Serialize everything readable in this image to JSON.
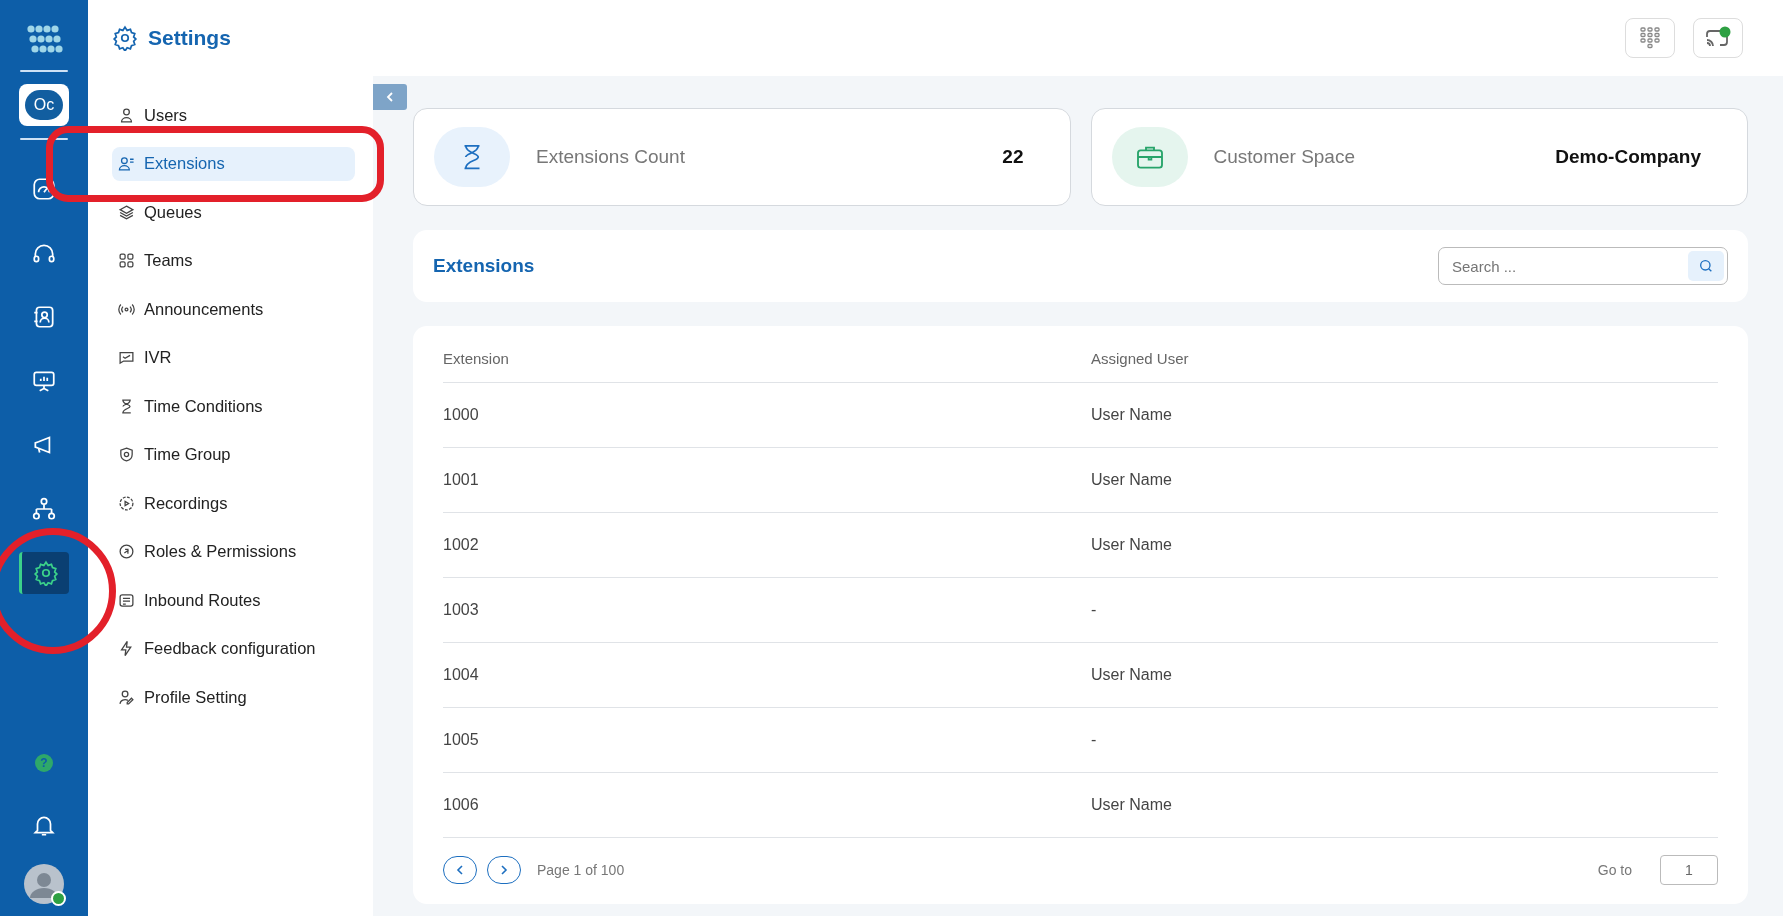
{
  "rail": {
    "workspace_badge": "Oc",
    "items": [
      {
        "selected": false
      },
      {
        "selected": false
      },
      {
        "selected": false
      },
      {
        "selected": false
      },
      {
        "selected": false
      },
      {
        "selected": false
      },
      {
        "selected": true
      }
    ],
    "help_mark": "?"
  },
  "settings_menu": {
    "title": "Settings",
    "items": [
      {
        "label": "Users",
        "selected": false
      },
      {
        "label": "Extensions",
        "selected": true
      },
      {
        "label": "Queues",
        "selected": false
      },
      {
        "label": "Teams",
        "selected": false
      },
      {
        "label": "Announcements",
        "selected": false
      },
      {
        "label": "IVR",
        "selected": false
      },
      {
        "label": "Time Conditions",
        "selected": false
      },
      {
        "label": "Time Group",
        "selected": false
      },
      {
        "label": "Recordings",
        "selected": false
      },
      {
        "label": "Roles & Permissions",
        "selected": false
      },
      {
        "label": "Inbound Routes",
        "selected": false
      },
      {
        "label": "Feedback configuration",
        "selected": false
      },
      {
        "label": "Profile Setting",
        "selected": false
      }
    ]
  },
  "stat_cards": [
    {
      "kind": "count",
      "label": "Extensions Count",
      "value": "22"
    },
    {
      "kind": "space",
      "label": "Customer Space",
      "value": "Demo-Company"
    }
  ],
  "extensions_panel": {
    "title": "Extensions",
    "search": {
      "placeholder": "Search ..."
    }
  },
  "table": {
    "columns": [
      "Extension",
      "Assigned User"
    ],
    "rows": [
      [
        "1000",
        "User Name"
      ],
      [
        "1001",
        "User Name"
      ],
      [
        "1002",
        "User Name"
      ],
      [
        "1003",
        "-"
      ],
      [
        "1004",
        "User Name"
      ],
      [
        "1005",
        "-"
      ],
      [
        "1006",
        "User Name"
      ]
    ]
  },
  "pagination": {
    "page_label": "Page 1 of 100",
    "goto_label": "Go to",
    "goto_value": "1"
  }
}
